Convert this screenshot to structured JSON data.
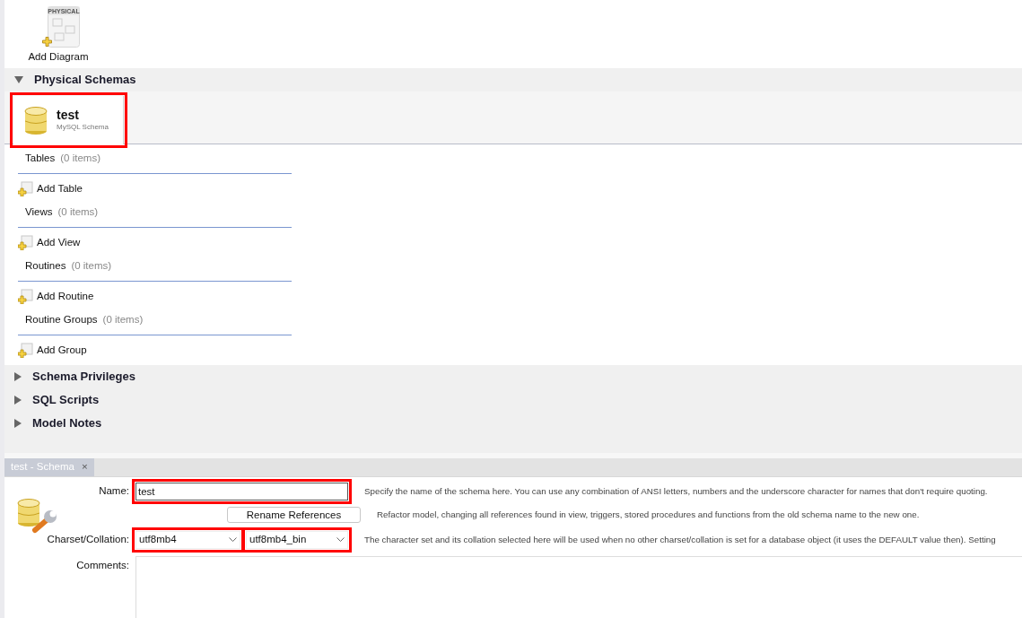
{
  "diagrams": {
    "add_label": "Add Diagram",
    "icon_caption": "PHYSICAL"
  },
  "sections": [
    {
      "title": "Physical Schemas",
      "expanded": true
    },
    {
      "title": "Schema Privileges",
      "expanded": false
    },
    {
      "title": "SQL Scripts",
      "expanded": false
    },
    {
      "title": "Model Notes",
      "expanded": false
    }
  ],
  "schema": {
    "name": "test",
    "subtitle": "MySQL Schema",
    "highlighted": true
  },
  "groups": [
    {
      "label": "Tables",
      "count": "(0 items)",
      "action": "Add Table"
    },
    {
      "label": "Views",
      "count": "(0 items)",
      "action": "Add View"
    },
    {
      "label": "Routines",
      "count": "(0 items)",
      "action": "Add Routine"
    },
    {
      "label": "Routine Groups",
      "count": "(0 items)",
      "action": "Add Group"
    }
  ],
  "editor": {
    "tab": {
      "label": "test - Schema",
      "close": "×",
      "selected": true
    },
    "name": {
      "label": "Name:",
      "value": "test",
      "highlighted": true,
      "help": "Specify the name of the schema here. You can use any combination of ANSI letters, numbers and the underscore character for names that don't require quoting."
    },
    "rename_button": "Rename References",
    "rename_help": "Refactor model, changing all references found in view, triggers, stored procedures and functions from the old schema name to the new one.",
    "charset": {
      "label": "Charset/Collation:",
      "charset": "utf8mb4",
      "collation": "utf8mb4_bin",
      "charset_highlighted": true,
      "collation_highlighted": true,
      "help": "The character set and its collation selected here will be used when no other charset/collation is set for a database object (it uses the DEFAULT value then). Setting"
    },
    "comments_label": "Comments:"
  }
}
